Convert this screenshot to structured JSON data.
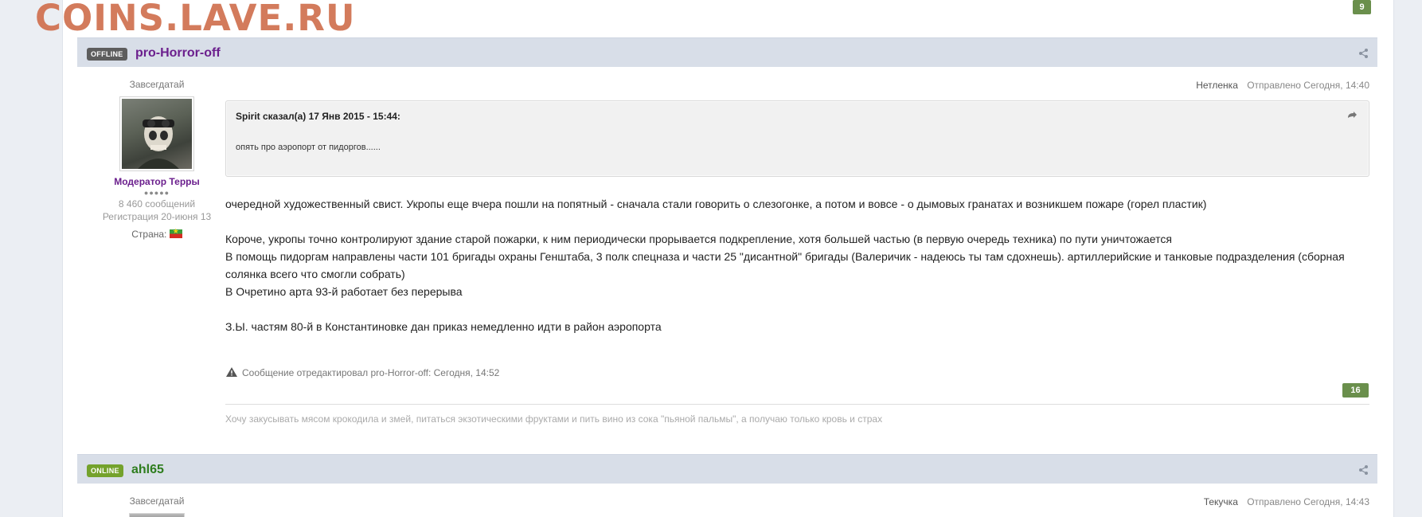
{
  "watermark": "COINS.LAVE.RU",
  "top_rep": "9",
  "posts": [
    {
      "status": "OFFLINE",
      "author": "pro-Horror-off",
      "author_color": "#6b1f8d",
      "member_title": "Завсегдатай",
      "group": "Модератор Терры",
      "pips": "●●●●●",
      "posts_count": "8 460 сообщений",
      "registered": "Регистрация 20-июня 13",
      "country_label": "Страна:",
      "post_tag": "Нетленка",
      "post_time": "Отправлено Сегодня, 14:40",
      "quote": {
        "cite": "Spirit сказал(а) 17 Янв 2015 - 15:44:",
        "text": "опять про аэропорт от пидоргов......"
      },
      "body_lines": [
        "очередной художественный свист. Укропы еще вчера пошли на попятный - сначала стали говорить о слезогонке, а потом и вовсе - о дымовых гранатах и возникшем пожаре (горел пластик)",
        "Короче, укропы точно контролируют здание старой пожарки, к ним периодически прорывается подкрепление, хотя большей частью (в первую очередь техника) по пути уничтожается",
        "В помощь пидоргам направлены части 101 бригады охраны Генштаба, 3 полк спецназа и части 25 \"дисантной\" бригады (Валеричик - надеюсь ты там сдохнешь). артиллерийские и танковые подразделения (сборная солянка всего что смогли собрать)",
        "В Очретино  арта 93-й работает без перерыва",
        "З.Ы. частям 80-й в Константиновке дан приказ немедленно идти в район аэропорта"
      ],
      "edit_note": "Сообщение отредактировал pro-Horror-off: Сегодня, 14:52",
      "rep": "16",
      "signature": "Хочу закусывать мясом крокодила и змей, питаться экзотическими фруктами и пить вино из сока \"пьяной пальмы\", а получаю только кровь и страх"
    },
    {
      "status": "ONLINE",
      "author": "ahl65",
      "author_color": "#2e7d1e",
      "member_title": "Завсегдатай",
      "post_tag": "Текучка",
      "post_time": "Отправлено Сегодня, 14:43"
    }
  ]
}
